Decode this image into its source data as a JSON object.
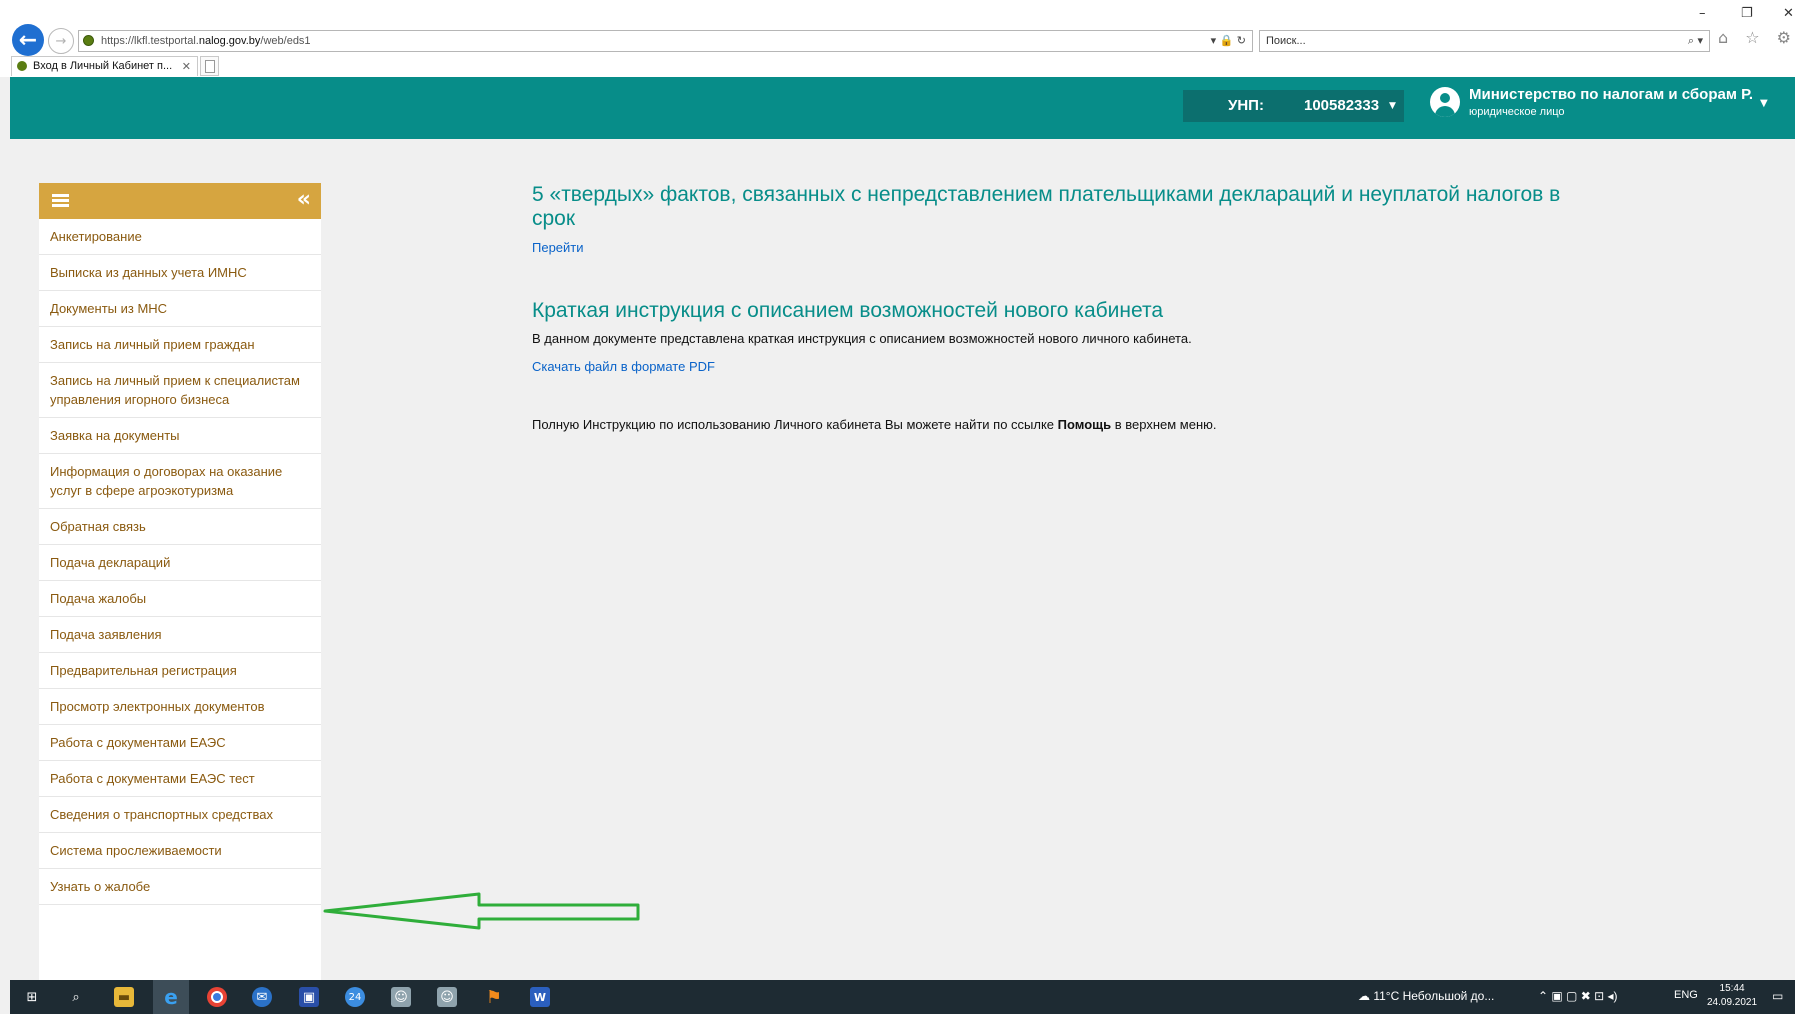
{
  "browser": {
    "url_prefix": "https://lkfl.testportal.",
    "url_domain": "nalog.gov.by",
    "url_path": "/web/eds1",
    "address_tools": "▾ 🔒 ↻",
    "search_placeholder": "Поиск...",
    "tab_title": "Вход в Личный Кабинет п...",
    "tab_close": "✕",
    "window_controls": {
      "minimize": "–",
      "restore": "❐",
      "close": "✕"
    },
    "toolbar_icons": "⌂ ☆ ⚙"
  },
  "header": {
    "unp_label": "УНП:",
    "unp_value": "100582333",
    "org_name": "Министерство по налогам и сборам Р...",
    "org_type": "юридическое лицо"
  },
  "sidebar": {
    "collapse_glyph": "«",
    "items": [
      {
        "label": "Анкетирование"
      },
      {
        "label": "Выписка из данных учета ИМНС"
      },
      {
        "label": "Документы из МНС"
      },
      {
        "label": "Запись на личный прием граждан"
      },
      {
        "label": "Запись на личный прием к специалистам управления игорного бизнеса"
      },
      {
        "label": "Заявка на документы"
      },
      {
        "label": "Информация о договорах на оказание услуг в сфере агроэкотуризма"
      },
      {
        "label": "Обратная связь"
      },
      {
        "label": "Подача деклараций"
      },
      {
        "label": "Подача жалобы"
      },
      {
        "label": "Подача заявления"
      },
      {
        "label": "Предварительная регистрация"
      },
      {
        "label": "Просмотр электронных документов"
      },
      {
        "label": "Работа с документами ЕАЭС"
      },
      {
        "label": "Работа с документами ЕАЭС тест"
      },
      {
        "label": "Сведения о транспортных средствах"
      },
      {
        "label": "Система прослеживаемости"
      },
      {
        "label": "Узнать о жалобе"
      }
    ]
  },
  "main": {
    "news_title": "5 «твердых» фактов, связанных с непредставлением плательщиками деклараций и неуплатой налогов в срок",
    "news_link": "Перейти",
    "instr_title": "Краткая инструкция с описанием возможностей нового кабинета",
    "instr_text": "В данном документе представлена краткая инструкция с описанием возможностей нового личного кабинета.",
    "instr_link": "Скачать файл в формате PDF",
    "help_prefix": "Полную Инструкцию по использованию Личного кабинета Вы можете найти по ссылке ",
    "help_bold": "Помощь",
    "help_suffix": " в верхнем меню."
  },
  "taskbar": {
    "weather": "11°C  Небольшой до...",
    "lang": "ENG",
    "time": "15:44",
    "date": "24.09.2021"
  },
  "colors": {
    "header": "#078d89",
    "sidebar_header": "#d6a540",
    "sidebar_text": "#8a5a10",
    "link": "#0a63c9",
    "annotation_arrow": "#2fae3a"
  }
}
